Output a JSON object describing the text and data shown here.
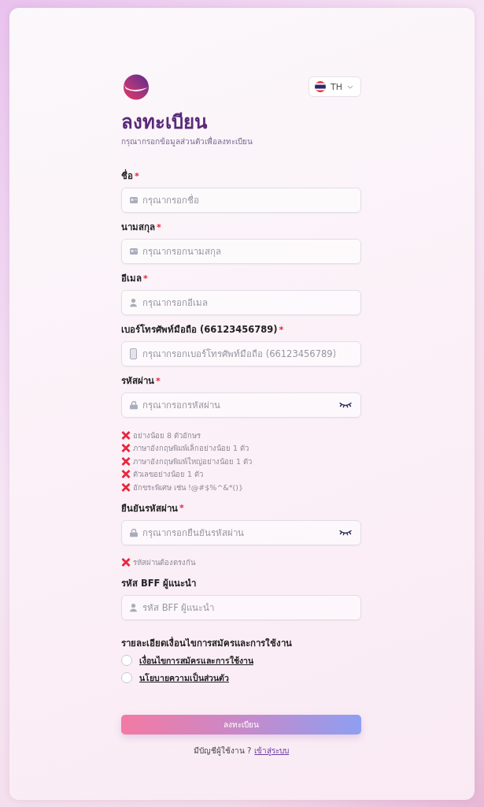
{
  "language": {
    "code": "TH"
  },
  "title": "ลงทะเบียน",
  "subtitle": "กรุณากรอกข้อมูลส่วนตัวเพื่อลงทะเบียน",
  "fields": [
    {
      "label": "ชื่อ",
      "required_mark": "*",
      "kind": "card",
      "placeholder": "กรุณากรอกชื่อ",
      "reveal_toggle": false
    },
    {
      "label": "นามสกุล",
      "required_mark": "*",
      "kind": "card",
      "placeholder": "กรุณากรอกนามสกุล",
      "reveal_toggle": false
    },
    {
      "label": "อีเมล",
      "required_mark": "*",
      "kind": "user",
      "placeholder": "กรุณากรอกอีเมล",
      "reveal_toggle": false
    },
    {
      "label": "เบอร์โทรศัพท์มือถือ (66123456789)",
      "required_mark": "*",
      "kind": "phone",
      "placeholder": "กรุณากรอกเบอร์โทรศัพท์มือถือ (66123456789)",
      "reveal_toggle": false
    },
    {
      "label": "รหัสผ่าน",
      "required_mark": "*",
      "kind": "lock",
      "placeholder": "กรุณากรอกรหัสผ่าน",
      "reveal_toggle": true,
      "rules": [
        {
          "text": "อย่างน้อย 8 ตัวอักษร",
          "met": false
        },
        {
          "text": "ภาษาอังกฤษพิมพ์เล็กอย่างน้อย 1 ตัว",
          "met": false
        },
        {
          "text": "ภาษาอังกฤษพิมพ์ใหญ่อย่างน้อย 1 ตัว",
          "met": false
        },
        {
          "text": "ตัวเลขอย่างน้อย 1 ตัว",
          "met": false
        },
        {
          "text": "อักขระพิเศษ เช่น !@#$%^&*()}",
          "met": false
        }
      ]
    },
    {
      "label": "ยืนยันรหัสผ่าน",
      "required_mark": "*",
      "kind": "lock",
      "placeholder": "กรุณากรอกยืนยันรหัสผ่าน",
      "reveal_toggle": true,
      "rules": [
        {
          "text": "รหัสผ่านต้องตรงกัน",
          "met": false
        }
      ]
    },
    {
      "label": "รหัส BFF ผู้แนะนำ",
      "kind": "user",
      "placeholder": "รหัส BFF ผู้แนะนำ",
      "reveal_toggle": false
    }
  ],
  "terms": {
    "heading": "รายละเอียดเงื่อนไขการสมัครและการใช้งาน",
    "options": [
      {
        "label": "เงื่อนไขการสมัครและการใช้งาน",
        "checked": false
      },
      {
        "label": "นโยบายความเป็นส่วนตัว",
        "checked": false
      }
    ]
  },
  "submit": "ลงทะเบียน",
  "footer": {
    "text": "มีบัญชีผู้ใช้งาน ?",
    "link": "เข้าสู่ระบบ"
  }
}
